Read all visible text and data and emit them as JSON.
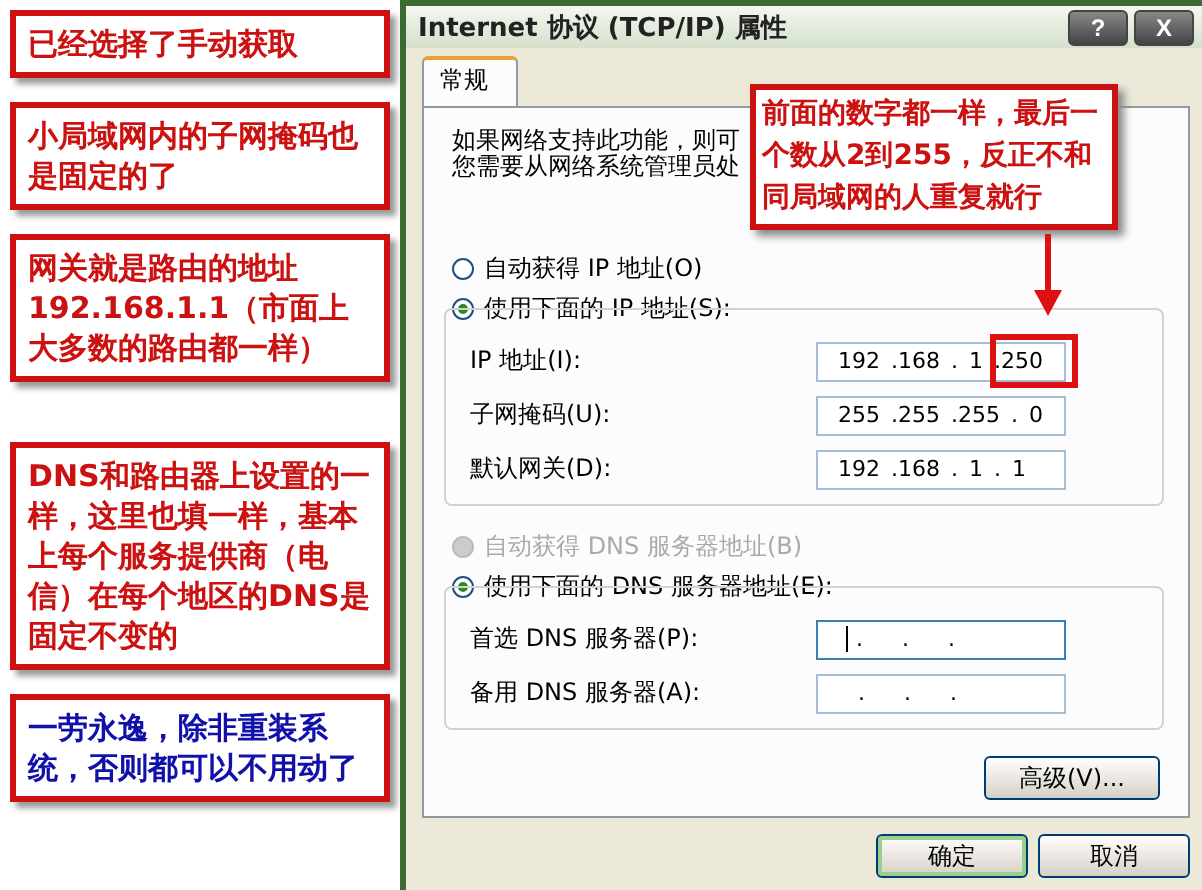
{
  "annotations": [
    {
      "text": "已经选择了手动获取",
      "color": "#cc1111"
    },
    {
      "text": "小局域网内的子网掩码也是固定的了",
      "color": "#cc1111"
    },
    {
      "text": "网关就是路由的地址192.168.1.1（市面上大多数的路由都一样）",
      "color": "#cc1111"
    },
    {
      "text": "DNS和路由器上设置的一样，这里也填一样，基本上每个服务提供商（电信）在每个地区的DNS是固定不变的",
      "color": "#cc1111"
    },
    {
      "text": "一劳永逸，除非重装系统，否则都可以不用动了",
      "color": "#1111aa"
    }
  ],
  "dialog": {
    "title": "Internet 协议 (TCP/IP) 属性",
    "help_button": "?",
    "close_button": "X",
    "tabs": [
      {
        "label": "常规",
        "selected": true
      }
    ],
    "intro": [
      "如果网络支持此功能，则可",
      "您需要从网络系统管理员处"
    ],
    "ip_auto": {
      "label": "自动获得 IP 地址(O)",
      "selected": false,
      "disabled": false
    },
    "ip_manual": {
      "label": "使用下面的 IP 地址(S):",
      "selected": true,
      "disabled": false
    },
    "ip_fields": [
      {
        "label": "IP 地址(I):",
        "value": "192 .168 . 1 .250",
        "focused": false
      },
      {
        "label": "子网掩码(U):",
        "value": "255 .255 .255 . 0",
        "focused": false
      },
      {
        "label": "默认网关(D):",
        "value": "192 .168 . 1 . 1",
        "focused": false
      }
    ],
    "dns_auto": {
      "label": "自动获得 DNS 服务器地址(B)",
      "selected": false,
      "disabled": true
    },
    "dns_manual": {
      "label": "使用下面的 DNS 服务器地址(E):",
      "selected": true,
      "disabled": false
    },
    "dns_fields": [
      {
        "label": "首选 DNS 服务器(P):",
        "value": ". . .",
        "focused": true
      },
      {
        "label": "备用 DNS 服务器(A):",
        "value": ". . .",
        "focused": false
      }
    ],
    "advanced_button": "高级(V)...",
    "buttons": [
      {
        "label": "确定",
        "default": true
      },
      {
        "label": "取消",
        "default": false
      }
    ]
  },
  "callout": {
    "text": "前面的数字都一样，最后一个数从2到255，反正不和同局域网的人重复就行"
  }
}
